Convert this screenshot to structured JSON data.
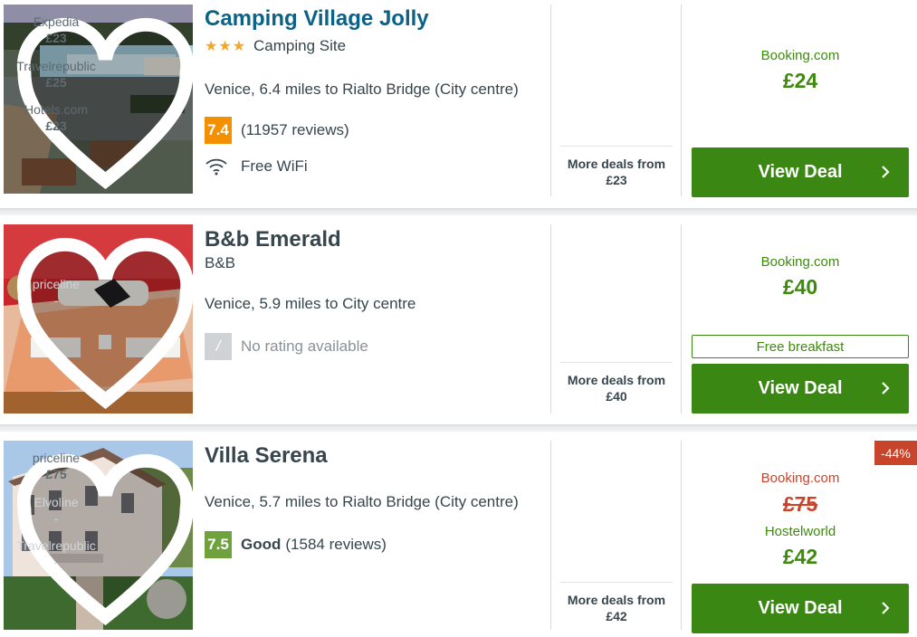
{
  "listings": [
    {
      "name": "Camping Village Jolly",
      "stars": "★★★",
      "type": "Camping Site",
      "location": "Venice, 6.4 miles to Rialto Bridge (City centre)",
      "score": "7.4",
      "score_label": "",
      "reviews": "(11957 reviews)",
      "amenity": "Free WiFi",
      "other_deals": [
        {
          "name": "Expedia",
          "price": "£23"
        },
        {
          "name": "Travelrepublic",
          "price": "£25"
        },
        {
          "name": "Hotels.com",
          "price": "£23"
        }
      ],
      "more_deals_label": "More deals from",
      "more_deals_price": "£23",
      "provider": "Booking.com",
      "price": "£24",
      "cta": "View Deal"
    },
    {
      "name": "B&b Emerald",
      "type": "B&B",
      "location": "Venice, 5.9 miles to City centre",
      "score": "/",
      "reviews": "No rating available",
      "other_deals": [
        {
          "name": "priceline",
          "price": "-"
        }
      ],
      "more_deals_label": "More deals from",
      "more_deals_price": "£40",
      "provider": "Booking.com",
      "price": "£40",
      "badge": "Free breakfast",
      "cta": "View Deal"
    },
    {
      "name": "Villa Serena",
      "location": "Venice, 5.7 miles to Rialto Bridge (City centre)",
      "score": "7.5",
      "score_label": "Good",
      "reviews": "(1584 reviews)",
      "other_deals": [
        {
          "name": "priceline",
          "price": "£75"
        },
        {
          "name": "Elvoline",
          "price": "-"
        },
        {
          "name": "Travelrepublic",
          "price": "-"
        }
      ],
      "more_deals_label": "More deals from",
      "more_deals_price": "£42",
      "discount": "-44%",
      "old_provider": "Booking.com",
      "old_price": "£75",
      "provider": "Hostelworld",
      "price": "£42",
      "cta": "View Deal"
    }
  ],
  "colors": {
    "title_blue": "#0a6286",
    "deal_green": "#3a8813",
    "price_green": "#3d8a0d",
    "rating_orange": "#f48f00",
    "rating_green": "#6fa23c",
    "discount_red": "#c8442b"
  }
}
